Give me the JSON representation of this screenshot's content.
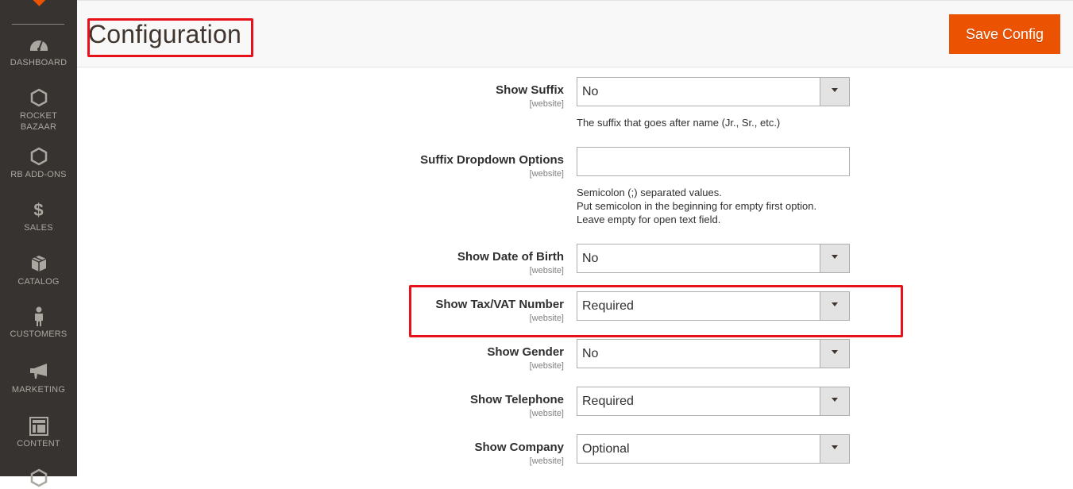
{
  "sidebar": {
    "items": [
      {
        "label": "DASHBOARD",
        "icon": "dashboard-icon"
      },
      {
        "label": "ROCKET BAZAAR",
        "label_line1": "ROCKET",
        "label_line2": "BAZAAR",
        "icon": "hexagon-icon"
      },
      {
        "label": "RB ADD-ONS",
        "icon": "hexagon-icon"
      },
      {
        "label": "SALES",
        "icon": "dollar-icon"
      },
      {
        "label": "CATALOG",
        "icon": "box-icon"
      },
      {
        "label": "CUSTOMERS",
        "icon": "person-icon"
      },
      {
        "label": "MARKETING",
        "icon": "megaphone-icon"
      },
      {
        "label": "CONTENT",
        "icon": "layout-icon"
      }
    ]
  },
  "header": {
    "title": "Configuration",
    "save_label": "Save Config"
  },
  "colors": {
    "accent": "#eb5202",
    "sidebar_bg": "#373330",
    "highlight": "#e8101b"
  },
  "fields": [
    {
      "label": "Show Suffix",
      "scope": "[website]",
      "type": "select",
      "value": "No",
      "note": "The suffix that goes after name (Jr., Sr., etc.)"
    },
    {
      "label": "Suffix Dropdown Options",
      "scope": "[website]",
      "type": "text",
      "value": "",
      "note_lines": [
        "Semicolon (;) separated values.",
        "Put semicolon in the beginning for empty first option.",
        "Leave empty for open text field."
      ]
    },
    {
      "label": "Show Date of Birth",
      "scope": "[website]",
      "type": "select",
      "value": "No"
    },
    {
      "label": "Show Tax/VAT Number",
      "scope": "[website]",
      "type": "select",
      "value": "Required",
      "highlighted": true
    },
    {
      "label": "Show Gender",
      "scope": "[website]",
      "type": "select",
      "value": "No"
    },
    {
      "label": "Show Telephone",
      "scope": "[website]",
      "type": "select",
      "value": "Required"
    },
    {
      "label": "Show Company",
      "scope": "[website]",
      "type": "select",
      "value": "Optional"
    }
  ]
}
